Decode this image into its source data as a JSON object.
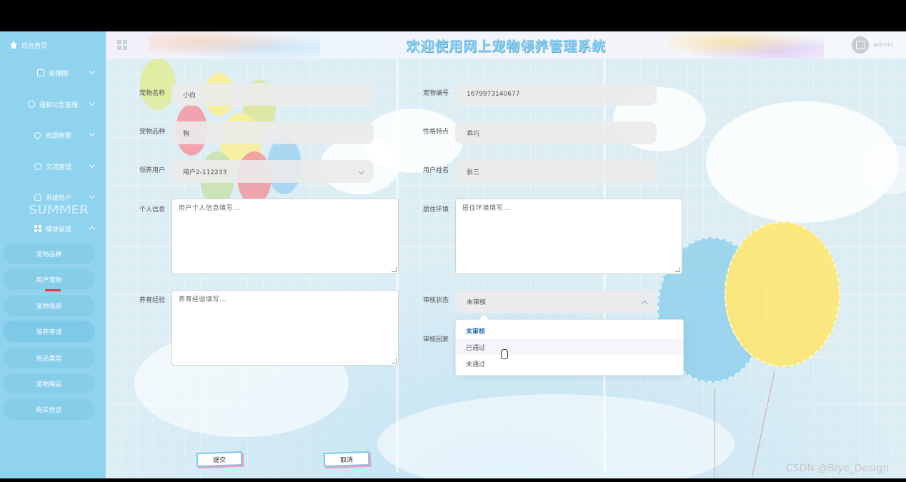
{
  "header": {
    "title": "欢迎使用网上宠物领养管理系统",
    "username": "admin"
  },
  "sidebar": {
    "home": "后台首页",
    "menus": [
      {
        "label": "轮播图",
        "icon": "image-icon"
      },
      {
        "label": "通知公告管理",
        "icon": "info-icon"
      },
      {
        "label": "资源管理",
        "icon": "location-icon"
      },
      {
        "label": "交流管理",
        "icon": "chat-icon"
      },
      {
        "label": "系统用户",
        "icon": "user-icon"
      },
      {
        "label": "模块管理",
        "icon": "grid-icon"
      }
    ],
    "submenu": [
      "宠物品种",
      "用户宠物",
      "宠物领养",
      "领养申请",
      "用品类型",
      "宠物用品",
      "购买信息"
    ]
  },
  "form": {
    "pet_name": {
      "label": "宠物名称",
      "value": "小白"
    },
    "pet_no": {
      "label": "宠物编号",
      "value": "1679973140677"
    },
    "breed": {
      "label": "宠物品种",
      "value": "狗"
    },
    "trait": {
      "label": "性格特点",
      "value": "乖巧"
    },
    "adopter": {
      "label": "领养用户",
      "value": "用户2-112233"
    },
    "user_name": {
      "label": "用户姓名",
      "value": "张三"
    },
    "personal_info": {
      "label": "个人信息",
      "placeholder": "用户个人信息填写..."
    },
    "living_env": {
      "label": "居住环境",
      "placeholder": "居住环境填写..."
    },
    "experience": {
      "label": "养育经验",
      "placeholder": "养育经验填写..."
    },
    "review_status": {
      "label": "审核状态",
      "value": "未审核",
      "options": [
        "未审核",
        "已通过",
        "未通过"
      ]
    },
    "review_reply": {
      "label": "审核回复"
    }
  },
  "buttons": {
    "submit": "提交",
    "cancel": "取消"
  },
  "watermark": "CSDN @Biye_Design"
}
